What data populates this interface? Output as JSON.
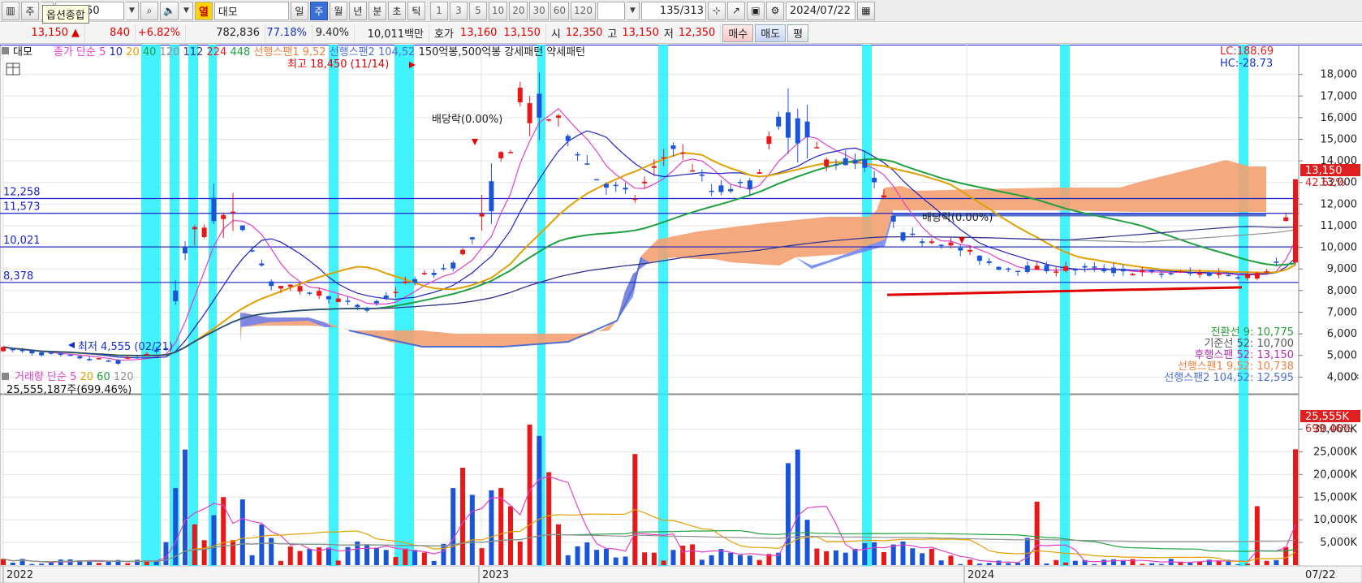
{
  "toolbar": {
    "mode_btn": "주",
    "code": "017350",
    "tooltip": "옵션종합",
    "market_badge": "열",
    "symbol_name": "대모",
    "periods": [
      "일",
      "주",
      "월",
      "년",
      "분",
      "초",
      "틱"
    ],
    "active_period": "주",
    "intervals": [
      "1",
      "3",
      "5",
      "10",
      "20",
      "30",
      "60",
      "120"
    ],
    "count": "135",
    "count_total": "/313",
    "date": "2024/07/22"
  },
  "quote": {
    "price": "13,150",
    "arrow": "▲",
    "change": "840",
    "change_pct": "+6.82%",
    "volume": "782,836",
    "vol_ratio": "77.18%",
    "turnover": "9.40%",
    "amount": "10,011백만",
    "hoga_label": "호가",
    "ask": "13,160",
    "bid": "13,150",
    "open_label": "시",
    "open": "12,350",
    "high_label": "고",
    "high": "13,150",
    "low_label": "저",
    "low": "12,350",
    "buy": "매수",
    "sell": "매도",
    "eval": "평"
  },
  "price_panel": {
    "tab": "대모",
    "legend_prefix": "종가 단순",
    "ma_legend": [
      {
        "label": "5",
        "color": "#e040c8"
      },
      {
        "label": "10",
        "color": "#2020c0"
      },
      {
        "label": "20",
        "color": "#e0a000"
      },
      {
        "label": "40",
        "color": "#20a040"
      },
      {
        "label": "120",
        "color": "#909090"
      },
      {
        "label": "112",
        "color": "#303090"
      },
      {
        "label": "224",
        "color": "#e02020"
      },
      {
        "label": "448",
        "color": "#20a040"
      }
    ],
    "legend_ichimoku_1": "선행스팬1 9,52",
    "legend_ichimoku_2": "선행스팬2 104,52",
    "legend_pattern": "150억봉,500억봉 강세패턴  약세패턴",
    "high_note": "최고 18,450 (11/14)",
    "low_note": "최저 4,555 (02/21)",
    "div_note_1": "배당락(0.00%)",
    "div_note_2": "배당락(0.00%)",
    "lc": "LC:188.69",
    "hc": "HC:-28.73",
    "current_tag": "13,150",
    "current_pct": "42.62%",
    "ichimoku_values": [
      {
        "text": "전환선 9: 10,775",
        "color": "#2a9a3a"
      },
      {
        "text": "기준선 52: 10,700",
        "color": "#555555"
      },
      {
        "text": "후행스팬 52: 13,150",
        "color": "#b030b0"
      },
      {
        "text": "선행스팬1 9,52: 10,738",
        "color": "#f08040"
      },
      {
        "text": "선행스팬2 104,52: 12,595",
        "color": "#5070d0"
      }
    ]
  },
  "volume_panel": {
    "legend_label": "거래량",
    "legend_prefix": "단순",
    "ma_legend": [
      {
        "label": "5",
        "color": "#e040c8"
      },
      {
        "label": "20",
        "color": "#e0a000"
      },
      {
        "label": "60",
        "color": "#20a040"
      },
      {
        "label": "120",
        "color": "#909090"
      }
    ],
    "current_text": "25,555,187주(699.46%)",
    "current_tag": "25,555K",
    "current_pct": "699.46%",
    "close_icon": "x"
  },
  "x_axis": {
    "labels": [
      "2022",
      "2023",
      "2024"
    ],
    "end_label": "07/22"
  },
  "chart_data": [
    {
      "type": "candlestick",
      "title": "대모 주봉",
      "ylim": [
        3600,
        18700
      ],
      "yticks": [
        4000,
        5000,
        6000,
        7000,
        8000,
        9000,
        10000,
        11000,
        12000,
        13000,
        14000,
        15000,
        16000,
        17000,
        18000
      ],
      "ytick_labels": [
        "4,000",
        "5,000",
        "6,000",
        "7,000",
        "8,000",
        "9,000",
        "10,000",
        "11,000",
        "12,000",
        "13,000",
        "14,000",
        "15,000",
        "16,000",
        "17,000",
        "18,000"
      ],
      "hlines": [
        {
          "value": 12258,
          "label": "12,258"
        },
        {
          "value": 11573,
          "label": "11,573"
        },
        {
          "value": 10021,
          "label": "10,021"
        },
        {
          "value": 8378,
          "label": "8,378"
        }
      ],
      "x_labels": [
        "2022",
        "2023",
        "2024"
      ],
      "last_close": 13150,
      "high": {
        "value": 18450,
        "date": "11/14"
      },
      "low": {
        "value": 4555,
        "date": "02/21"
      },
      "support_line": [
        7800,
        8150
      ]
    },
    {
      "type": "bar",
      "title": "거래량",
      "ylim": [
        0,
        36000
      ],
      "yticks": [
        5000,
        10000,
        15000,
        20000,
        25000,
        30000
      ],
      "ytick_labels": [
        "5,000K",
        "10,000K",
        "15,000K",
        "20,000K",
        "25,000K",
        "30,000K"
      ],
      "last_value_k": 25555
    }
  ]
}
